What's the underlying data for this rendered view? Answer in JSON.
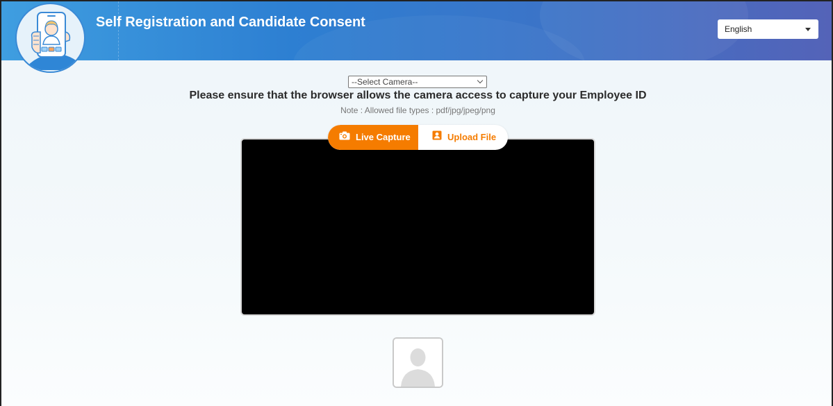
{
  "header": {
    "title": "Self Registration and Candidate Consent",
    "language": "English"
  },
  "camera": {
    "selected": "--Select Camera--"
  },
  "instruction": "Please ensure that the browser allows the camera access to capture your Employee ID",
  "note": "Note : Allowed file types : pdf/jpg/jpeg/png",
  "tabs": {
    "live": "Live Capture",
    "upload": "Upload File"
  },
  "colors": {
    "accent": "#f57c00",
    "header_start": "#3f9ee0",
    "header_end": "#5463b8"
  },
  "icons": {
    "logo": "phone-selfie-icon",
    "live": "camera-icon",
    "upload": "id-card-icon",
    "avatar": "user-placeholder-icon"
  }
}
